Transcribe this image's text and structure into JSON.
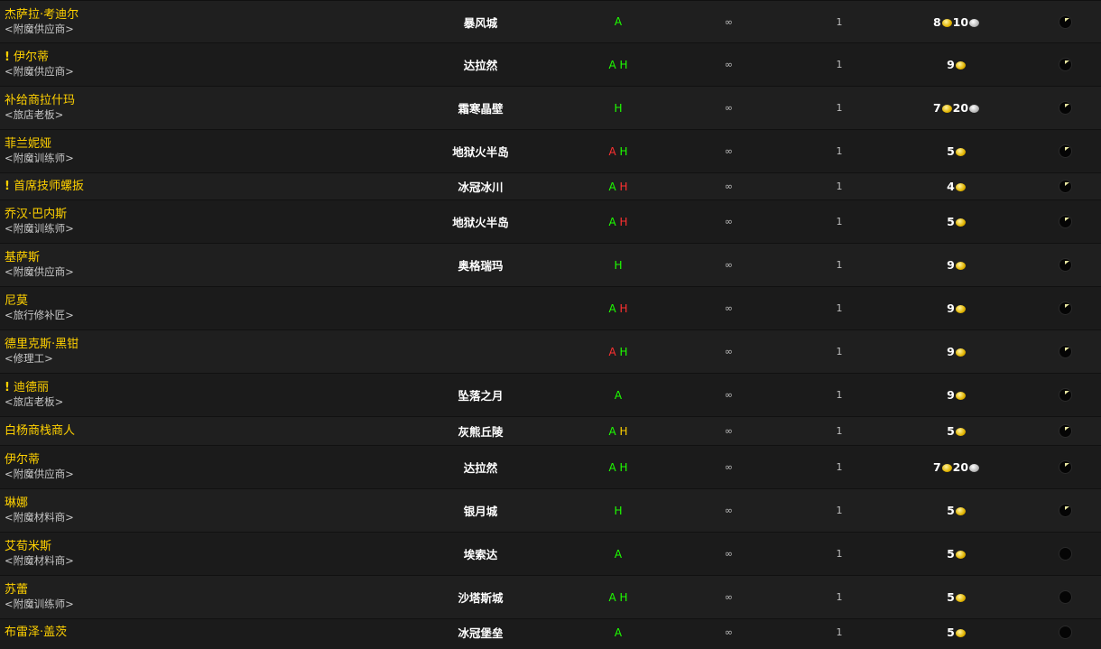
{
  "rows": [
    {
      "name": "杰萨拉·考迪尔",
      "tag": "<附魔供应商>",
      "quest": false,
      "zone": "暴风城",
      "react": [
        {
          "t": "A",
          "c": "#1eff00"
        }
      ],
      "stock": "∞",
      "qty": "1",
      "gold": "8",
      "silver": "10",
      "flag": true
    },
    {
      "name": "伊尔蒂",
      "tag": "<附魔供应商>",
      "quest": true,
      "zone": "达拉然",
      "react": [
        {
          "t": "A",
          "c": "#1eff00"
        },
        {
          "t": "H",
          "c": "#1eff00"
        }
      ],
      "stock": "∞",
      "qty": "1",
      "gold": "9",
      "silver": "",
      "flag": true
    },
    {
      "name": "补给商拉什玛",
      "tag": "<旅店老板>",
      "quest": false,
      "zone": "霜寒晶壁",
      "react": [
        {
          "t": "H",
          "c": "#1eff00"
        }
      ],
      "stock": "∞",
      "qty": "1",
      "gold": "7",
      "silver": "20",
      "flag": true
    },
    {
      "name": "菲兰妮娅",
      "tag": "<附魔训练师>",
      "quest": false,
      "zone": "地狱火半岛",
      "react": [
        {
          "t": "A",
          "c": "#ff3030"
        },
        {
          "t": "H",
          "c": "#1eff00"
        }
      ],
      "stock": "∞",
      "qty": "1",
      "gold": "5",
      "silver": "",
      "flag": true
    },
    {
      "name": "首席技师螺扳",
      "tag": "",
      "quest": true,
      "zone": "冰冠冰川",
      "react": [
        {
          "t": "A",
          "c": "#1eff00"
        },
        {
          "t": "H",
          "c": "#ff3030"
        }
      ],
      "stock": "∞",
      "qty": "1",
      "gold": "4",
      "silver": "",
      "flag": true
    },
    {
      "name": "乔汉·巴内斯",
      "tag": "<附魔训练师>",
      "quest": false,
      "zone": "地狱火半岛",
      "react": [
        {
          "t": "A",
          "c": "#1eff00"
        },
        {
          "t": "H",
          "c": "#ff3030"
        }
      ],
      "stock": "∞",
      "qty": "1",
      "gold": "5",
      "silver": "",
      "flag": true
    },
    {
      "name": "基萨斯",
      "tag": "<附魔供应商>",
      "quest": false,
      "zone": "奥格瑞玛",
      "react": [
        {
          "t": "H",
          "c": "#1eff00"
        }
      ],
      "stock": "∞",
      "qty": "1",
      "gold": "9",
      "silver": "",
      "flag": true
    },
    {
      "name": "尼莫",
      "tag": "<旅行修补匠>",
      "quest": false,
      "zone": "",
      "react": [
        {
          "t": "A",
          "c": "#1eff00"
        },
        {
          "t": "H",
          "c": "#ff3030"
        }
      ],
      "stock": "∞",
      "qty": "1",
      "gold": "9",
      "silver": "",
      "flag": true
    },
    {
      "name": "德里克斯·黑钳",
      "tag": "<修理工>",
      "quest": false,
      "zone": "",
      "react": [
        {
          "t": "A",
          "c": "#ff3030"
        },
        {
          "t": "H",
          "c": "#1eff00"
        }
      ],
      "stock": "∞",
      "qty": "1",
      "gold": "9",
      "silver": "",
      "flag": true
    },
    {
      "name": "迪德丽",
      "tag": "<旅店老板>",
      "quest": true,
      "zone": "坠落之月",
      "react": [
        {
          "t": "A",
          "c": "#1eff00"
        }
      ],
      "stock": "∞",
      "qty": "1",
      "gold": "9",
      "silver": "",
      "flag": true
    },
    {
      "name": "白杨商栈商人",
      "tag": "",
      "quest": false,
      "zone": "灰熊丘陵",
      "react": [
        {
          "t": "A",
          "c": "#1eff00"
        },
        {
          "t": "H",
          "c": "#ffd100"
        }
      ],
      "stock": "∞",
      "qty": "1",
      "gold": "5",
      "silver": "",
      "flag": true
    },
    {
      "name": "伊尔蒂",
      "tag": "<附魔供应商>",
      "quest": false,
      "zone": "达拉然",
      "react": [
        {
          "t": "A",
          "c": "#1eff00"
        },
        {
          "t": "H",
          "c": "#1eff00"
        }
      ],
      "stock": "∞",
      "qty": "1",
      "gold": "7",
      "silver": "20",
      "flag": true
    },
    {
      "name": "琳娜",
      "tag": "<附魔材料商>",
      "quest": false,
      "zone": "银月城",
      "react": [
        {
          "t": "H",
          "c": "#1eff00"
        }
      ],
      "stock": "∞",
      "qty": "1",
      "gold": "5",
      "silver": "",
      "flag": true
    },
    {
      "name": "艾荀米斯",
      "tag": "<附魔材料商>",
      "quest": false,
      "zone": "埃索达",
      "react": [
        {
          "t": "A",
          "c": "#1eff00"
        }
      ],
      "stock": "∞",
      "qty": "1",
      "gold": "5",
      "silver": "",
      "flag": false
    },
    {
      "name": "苏蕾",
      "tag": "<附魔训练师>",
      "quest": false,
      "zone": "沙塔斯城",
      "react": [
        {
          "t": "A",
          "c": "#1eff00"
        },
        {
          "t": "H",
          "c": "#1eff00"
        }
      ],
      "stock": "∞",
      "qty": "1",
      "gold": "5",
      "silver": "",
      "flag": false
    },
    {
      "name": "布雷泽·盖茨",
      "tag": "",
      "quest": false,
      "zone": "冰冠堡垒",
      "react": [
        {
          "t": "A",
          "c": "#1eff00"
        }
      ],
      "stock": "∞",
      "qty": "1",
      "gold": "5",
      "silver": "",
      "flag": false
    }
  ]
}
